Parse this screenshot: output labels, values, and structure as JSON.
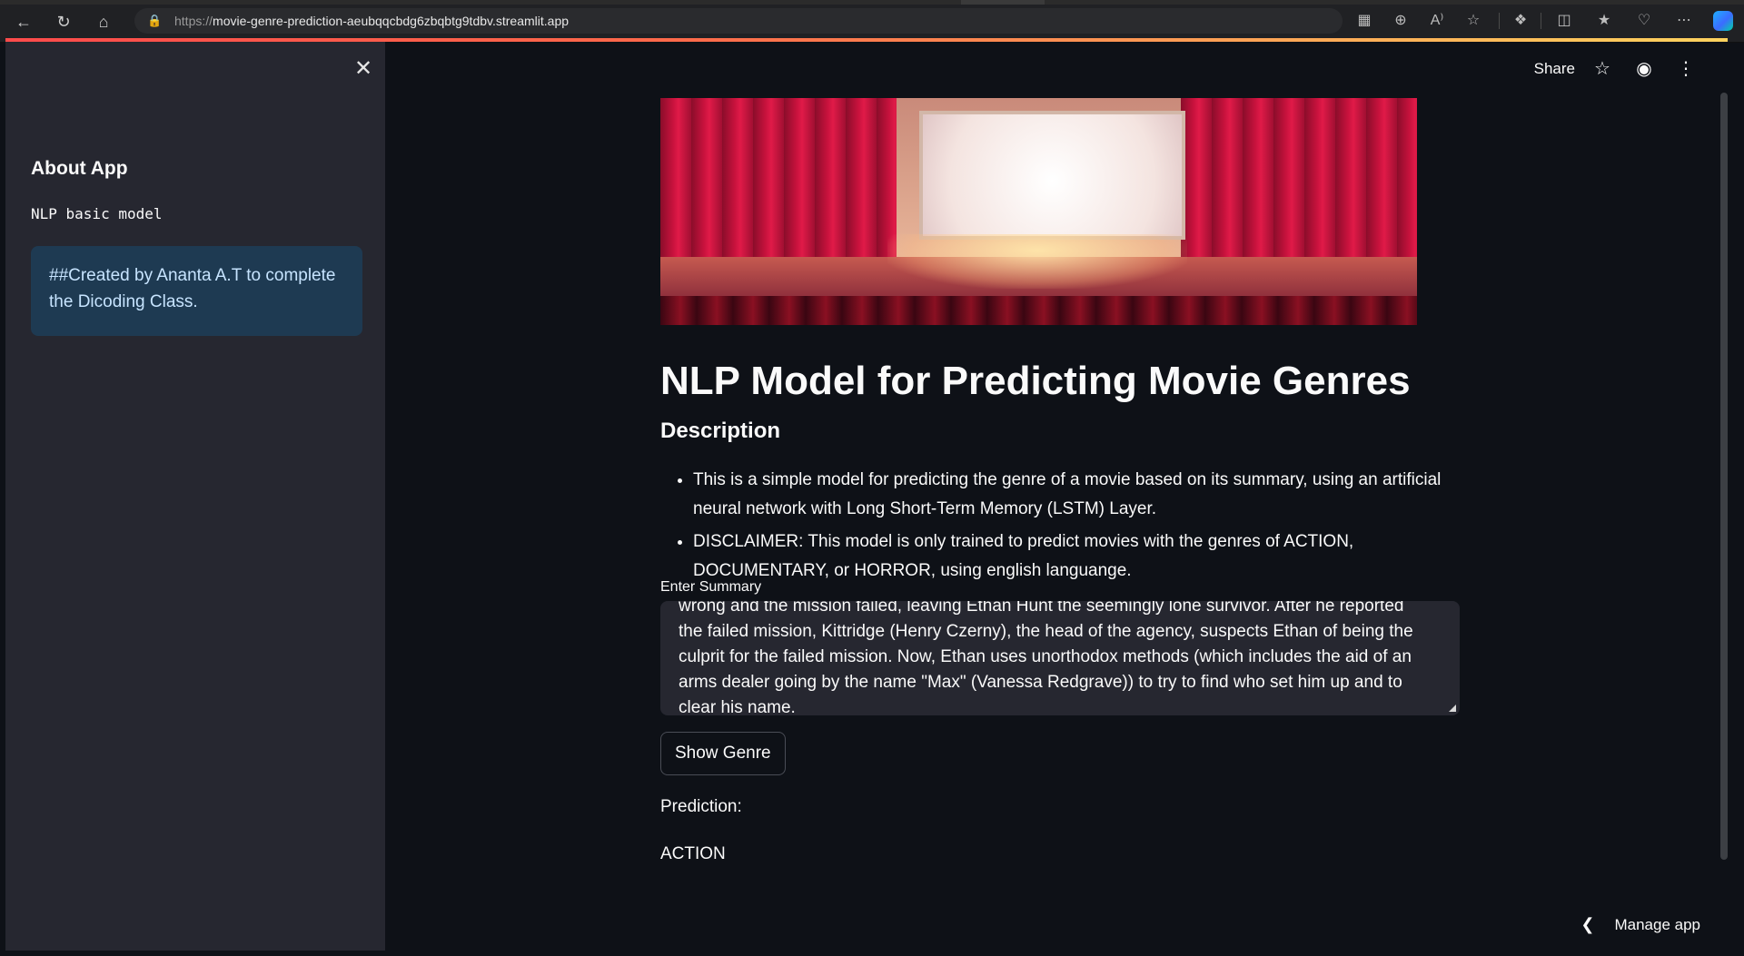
{
  "browser": {
    "url_scheme": "https://",
    "url_host": "movie-genre-prediction-aeubqqcbdg6zbqbtg9tdbv.streamlit.app"
  },
  "sidebar": {
    "title": "About App",
    "code_text": "NLP basic model",
    "info_text": "##Created by Ananta A.T to complete the Dicoding Class."
  },
  "header": {
    "share_label": "Share"
  },
  "main": {
    "title": "NLP Model for Predicting Movie Genres",
    "description_title": "Description",
    "bullets": [
      "This is a simple model for predicting the genre of a movie based on its summary, using an artificial neural network with Long Short-Term Memory (LSTM) Layer.",
      "DISCLAIMER: This model is only trained to predict movies with the genres of ACTION, DOCUMENTARY, or HORROR, using english languange."
    ],
    "summary_label": "Enter Summary",
    "summary_value": "wrong and the mission failed, leaving Ethan Hunt the seemingly lone survivor. After he reported the failed mission, Kittridge (Henry Czerny), the head of the agency, suspects Ethan of being the culprit for the failed mission. Now, Ethan uses unorthodox methods (which includes the aid of an arms dealer going by the name \"Max\" (Vanessa Redgrave)) to try to find who set him up and to clear his name.",
    "show_button_label": "Show Genre",
    "prediction_label": "Prediction:",
    "prediction_value": "ACTION"
  },
  "footer": {
    "manage_app_label": "Manage app"
  },
  "colors": {
    "background": "#0e1117",
    "sidebar": "#262730",
    "info_box": "#1e3a52",
    "accent": "#ff4b4b"
  }
}
